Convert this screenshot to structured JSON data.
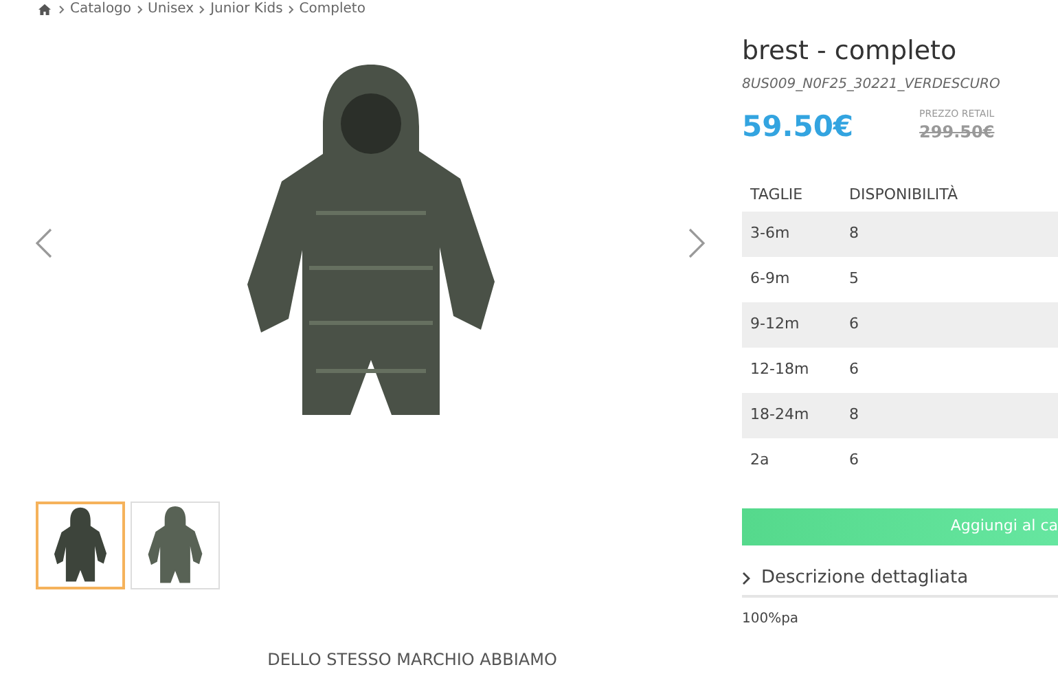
{
  "breadcrumb": [
    "Catalogo",
    "Unisex",
    "Junior Kids",
    "Completo"
  ],
  "gallery": {
    "thumbnails": [
      {
        "selected": true
      },
      {
        "selected": false
      }
    ]
  },
  "product": {
    "title": "brest - completo",
    "code": "8US009_N0F25_30221_VERDESCURO",
    "price": "59.50€",
    "retail_label": "PREZZO RETAIL",
    "retail_price": "299.50€",
    "sizes": {
      "columns": [
        "TAGLIE",
        "DISPONIBILITÀ"
      ],
      "rows": [
        [
          "3-6m",
          "8"
        ],
        [
          "6-9m",
          "5"
        ],
        [
          "9-12m",
          "6"
        ],
        [
          "12-18m",
          "6"
        ],
        [
          "18-24m",
          "8"
        ],
        [
          "2a",
          "6"
        ]
      ]
    },
    "add_button": "Aggiungi al ca",
    "description_toggle": "Descrizione dettagliata",
    "description": "100%pa"
  },
  "related_heading": "DELLO STESSO MARCHIO ABBIAMO"
}
